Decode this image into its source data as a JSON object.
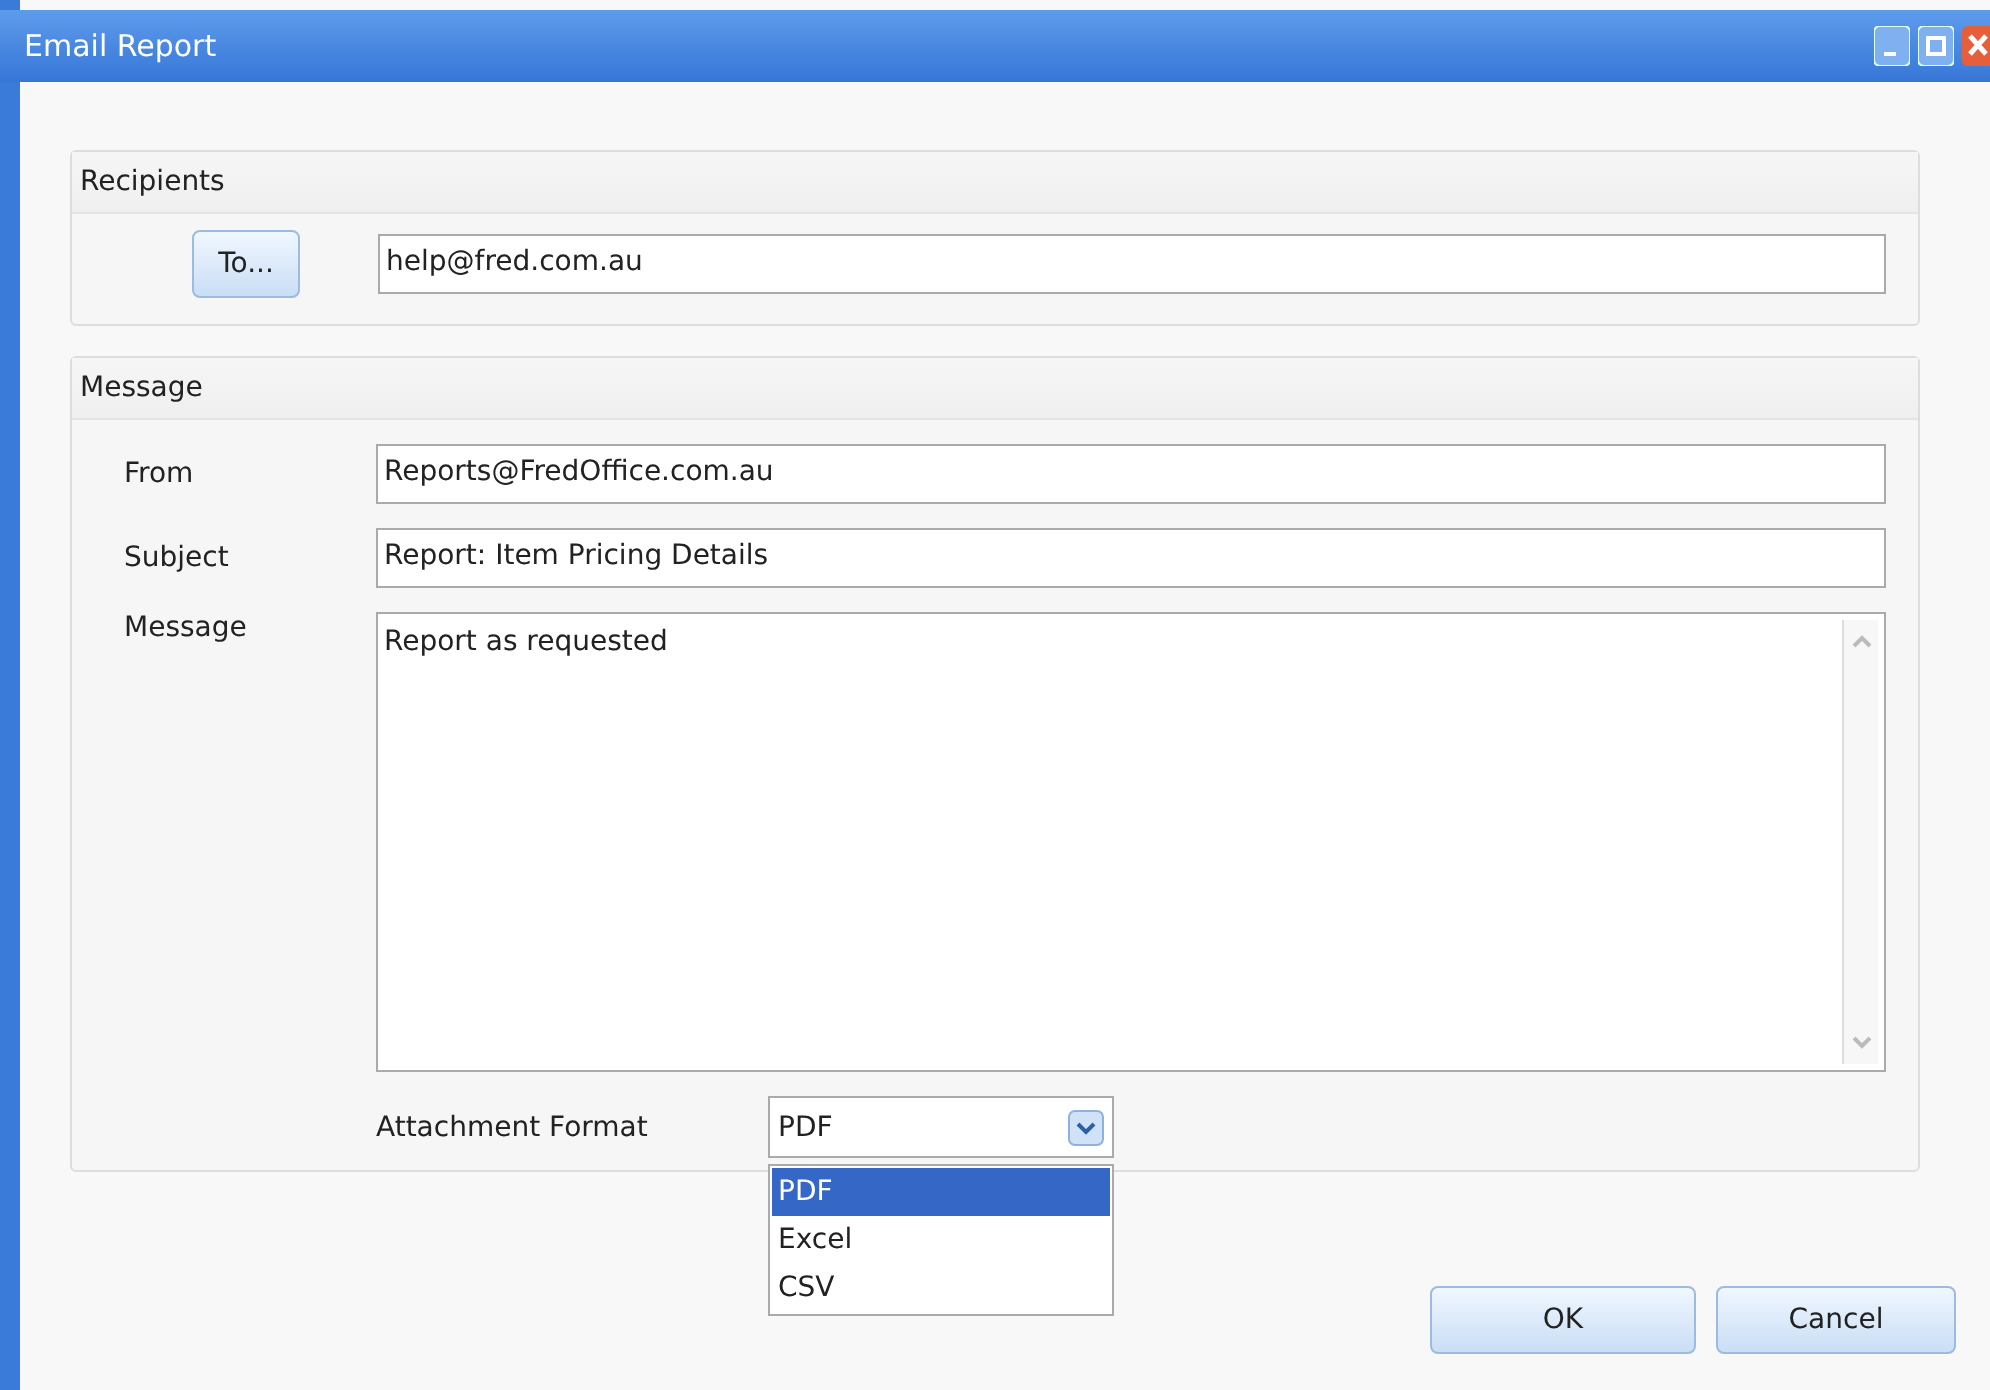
{
  "window": {
    "title": "Email Report"
  },
  "recipients": {
    "title": "Recipients",
    "to_button": "To...",
    "to_value": "help@fred.com.au"
  },
  "message_section": {
    "title": "Message",
    "fields": [
      {
        "label": "From",
        "value": "Reports@FredOffice.com.au"
      },
      {
        "label": "Subject",
        "value": "Report: Item Pricing Details"
      }
    ],
    "message": {
      "label": "Message",
      "value": "Report as requested"
    },
    "attachment": {
      "label": "Attachment Format",
      "value": "PDF",
      "expanded": true,
      "options": [
        {
          "label": "PDF",
          "selected": true
        },
        {
          "label": "Excel",
          "selected": false
        },
        {
          "label": "CSV",
          "selected": false
        }
      ]
    }
  },
  "buttons": [
    "OK",
    "Cancel"
  ]
}
